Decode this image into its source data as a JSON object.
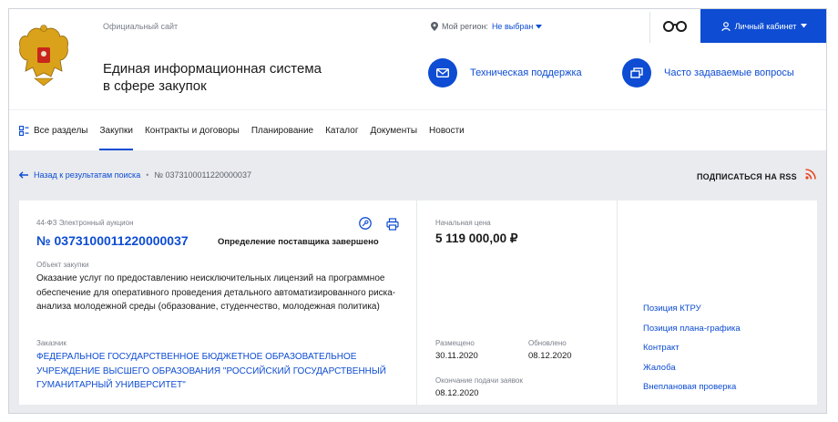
{
  "header": {
    "official_site": "Официальный сайт",
    "title_line1": "Единая информационная система",
    "title_line2": "в сфере закупок",
    "region_label": "Мой регион:",
    "region_value": "Не выбран",
    "cabinet": "Личный кабинет",
    "support": "Техническая поддержка",
    "faq": "Часто задаваемые вопросы"
  },
  "nav": {
    "items": [
      "Все разделы",
      "Закупки",
      "Контракты и договоры",
      "Планирование",
      "Каталог",
      "Документы",
      "Новости"
    ],
    "active": "Закупки"
  },
  "breadcrumb": {
    "back": "Назад к результатам поиска",
    "current": "№ 0373100011220000037"
  },
  "rss": "ПОДПИСАТЬСЯ НА RSS",
  "card": {
    "law": "44-ФЗ Электронный аукцион",
    "number": "№ 0373100011220000037",
    "status": "Определение поставщика завершено",
    "object_label": "Объект закупки",
    "object_text": "Оказание услуг по предоставлению неисключительных лицензий на программное обеспечение для оперативного проведения детального автоматизированного риска-анализа молодежной  среды (образование, студенчество, молодежная политика)",
    "customer_label": "Заказчик",
    "customer_text": "ФЕДЕРАЛЬНОЕ ГОСУДАРСТВЕННОЕ БЮДЖЕТНОЕ ОБРАЗОВАТЕЛЬНОЕ УЧРЕЖДЕНИЕ ВЫСШЕГО ОБРАЗОВАНИЯ \"РОССИЙСКИЙ ГОСУДАРСТВЕННЫЙ ГУМАНИТАРНЫЙ УНИВЕРСИТЕТ\"",
    "price_label": "Начальная цена",
    "price": "5 119 000,00 ₽",
    "placed_label": "Размещено",
    "placed": "30.11.2020",
    "updated_label": "Обновлено",
    "updated": "08.12.2020",
    "deadline_label": "Окончание подачи заявок",
    "deadline": "08.12.2020",
    "links": [
      "Позиция КТРУ",
      "Позиция плана-графика",
      "Контракт",
      "Жалоба",
      "Внеплановая проверка"
    ]
  },
  "colors": {
    "accent": "#0d4cd3",
    "rss": "#e8451e",
    "background": "#e9ebef"
  }
}
